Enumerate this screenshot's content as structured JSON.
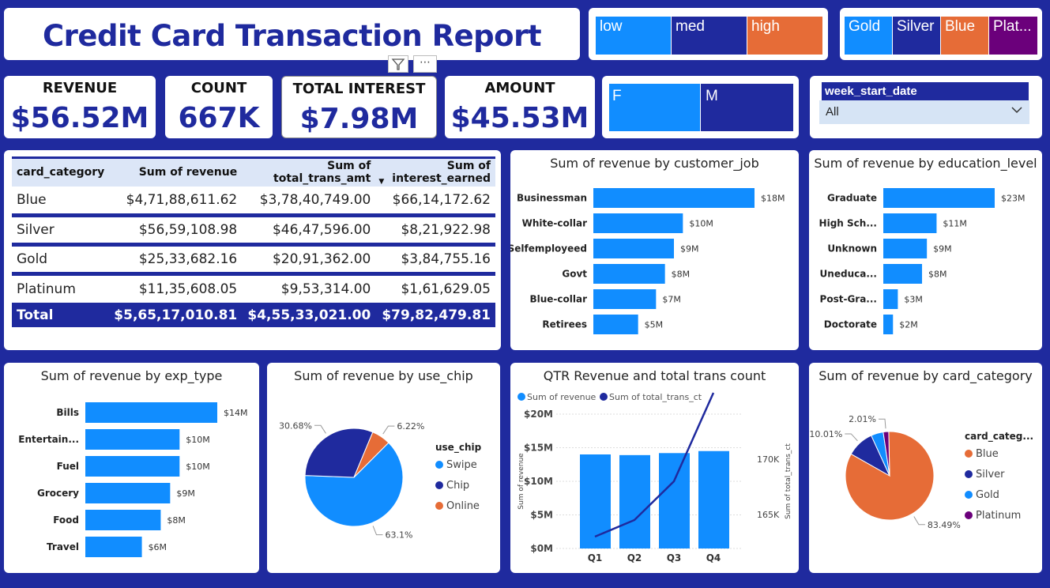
{
  "title": "Credit Card Transaction Report",
  "income_slicer": [
    "low",
    "med",
    "high"
  ],
  "card_slicer": [
    "Gold",
    "Silver",
    "Blue",
    "Plat..."
  ],
  "gender_slicer": [
    "F",
    "M"
  ],
  "kpis": [
    {
      "label": "REVENUE",
      "value": "$56.52M"
    },
    {
      "label": "COUNT",
      "value": "667K"
    },
    {
      "label": "TOTAL INTEREST",
      "value": "$7.98M"
    },
    {
      "label": "AMOUNT",
      "value": "$45.53M"
    }
  ],
  "week_filter": {
    "label": "week_start_date",
    "value": "All"
  },
  "matrix": {
    "headers": [
      "card_category",
      "Sum of revenue",
      "Sum of total_trans_amt",
      "Sum of interest_earned"
    ],
    "rows": [
      [
        "Blue",
        "$4,71,88,611.62",
        "$3,78,40,749.00",
        "$66,14,172.62"
      ],
      [
        "Silver",
        "$56,59,108.98",
        "$46,47,596.00",
        "$8,21,922.98"
      ],
      [
        "Gold",
        "$25,33,682.16",
        "$20,91,362.00",
        "$3,84,755.16"
      ],
      [
        "Platinum",
        "$11,35,608.05",
        "$9,53,314.00",
        "$1,61,629.05"
      ]
    ],
    "total": [
      "Total",
      "$5,65,17,010.81",
      "$4,55,33,021.00",
      "$79,82,479.81"
    ]
  },
  "colors": {
    "navy": "#1F2A9E",
    "blue": "#118DFF",
    "orange": "#E66C37",
    "purple": "#6B007B"
  },
  "chart_data": [
    {
      "type": "bar",
      "title": "Sum of revenue by customer_job",
      "categories": [
        "Businessman",
        "White-collar",
        "Selfemployeed",
        "Govt",
        "Blue-collar",
        "Retirees"
      ],
      "values": [
        18,
        10,
        9,
        8,
        7,
        5
      ],
      "labels": [
        "$18M",
        "$10M",
        "$9M",
        "$8M",
        "$7M",
        "$5M"
      ]
    },
    {
      "type": "bar",
      "title": "Sum of revenue by education_level",
      "categories": [
        "Graduate",
        "High Sch...",
        "Unknown",
        "Uneduca...",
        "Post-Gra...",
        "Doctorate"
      ],
      "values": [
        23,
        11,
        9,
        8,
        3,
        2
      ],
      "labels": [
        "$23M",
        "$11M",
        "$9M",
        "$8M",
        "$3M",
        "$2M"
      ]
    },
    {
      "type": "bar",
      "title": "Sum of revenue by exp_type",
      "categories": [
        "Bills",
        "Entertain...",
        "Fuel",
        "Grocery",
        "Food",
        "Travel"
      ],
      "values": [
        14,
        10,
        10,
        9,
        8,
        6
      ],
      "labels": [
        "$14M",
        "$10M",
        "$10M",
        "$9M",
        "$8M",
        "$6M"
      ]
    },
    {
      "type": "pie",
      "title": "Sum of revenue by use_chip",
      "legend_title": "use_chip",
      "categories": [
        "Swipe",
        "Chip",
        "Online"
      ],
      "values": [
        63.1,
        30.68,
        6.22
      ],
      "labels": [
        "63.1%",
        "30.68%",
        "6.22%"
      ],
      "colors": [
        "#118DFF",
        "#1F2A9E",
        "#E66C37"
      ]
    },
    {
      "type": "bar",
      "title": "QTR Revenue and total trans count",
      "categories": [
        "Q1",
        "Q2",
        "Q3",
        "Q4"
      ],
      "series": [
        {
          "name": "Sum of revenue",
          "values": [
            14.0,
            13.9,
            14.2,
            14.5
          ]
        },
        {
          "name": "Sum of total_trans_ct",
          "values": [
            163000,
            164500,
            168000,
            176000
          ]
        }
      ],
      "ylabel": "Sum of revenue",
      "y2label": "Sum of total_trans_ct",
      "yticks": [
        "$0M",
        "$5M",
        "$10M",
        "$15M",
        "$20M"
      ],
      "y2ticks": [
        "165K",
        "170K"
      ],
      "ylim": [
        0,
        20
      ]
    },
    {
      "type": "pie",
      "title": "Sum of revenue by card_category",
      "legend_title": "card_categ...",
      "categories": [
        "Blue",
        "Silver",
        "Gold",
        "Platinum"
      ],
      "values": [
        83.49,
        10.01,
        4.49,
        2.01
      ],
      "labels": [
        "83.49%",
        "10.01%",
        "",
        "2.01%"
      ],
      "colors": [
        "#E66C37",
        "#1F2A9E",
        "#118DFF",
        "#6B007B"
      ]
    }
  ]
}
